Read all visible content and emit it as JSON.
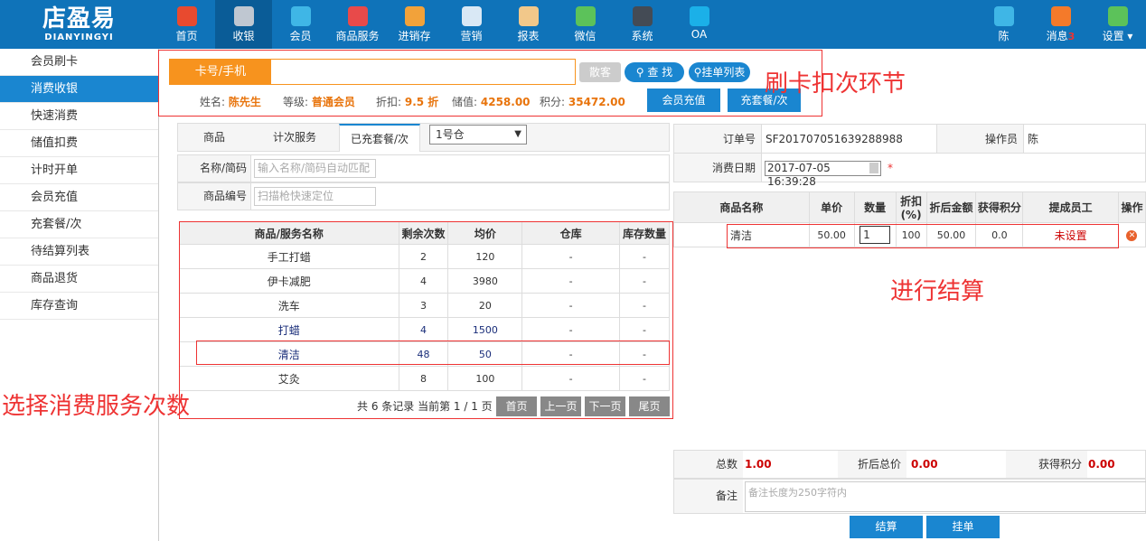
{
  "logo": {
    "cn": "店盈易",
    "en": "DIANYINGYI"
  },
  "nav": [
    {
      "label": "首页",
      "icon": "home-icon",
      "color": "#e84a2f"
    },
    {
      "label": "收银",
      "icon": "cash-register-icon",
      "color": "#bfc7d1"
    },
    {
      "label": "会员",
      "icon": "member-icon",
      "color": "#3fb6e6"
    },
    {
      "label": "商品服务",
      "icon": "goods-icon",
      "color": "#e84a4a"
    },
    {
      "label": "进销存",
      "icon": "inventory-icon",
      "color": "#f2a23a"
    },
    {
      "label": "营销",
      "icon": "megaphone-icon",
      "color": "#d9e8f5"
    },
    {
      "label": "报表",
      "icon": "report-icon",
      "color": "#f2c88a"
    },
    {
      "label": "微信",
      "icon": "wechat-icon",
      "color": "#5cc25a"
    },
    {
      "label": "系统",
      "icon": "monitor-icon",
      "color": "#444b55"
    },
    {
      "label": "OA",
      "icon": "oa-icon",
      "color": "#1bb0e8"
    }
  ],
  "right_nav": {
    "user": "陈",
    "msg": "消息",
    "msg_count": "3",
    "settings": "设置"
  },
  "sidebar": [
    "会员刷卡",
    "消费收银",
    "快速消费",
    "储值扣费",
    "计时开单",
    "会员充值",
    "充套餐/次",
    "待结算列表",
    "商品退货",
    "库存查询"
  ],
  "card": {
    "label": "卡号/手机",
    "btn_scatter": "散客",
    "btn_search": "查 找",
    "btn_hang": "挂单列表"
  },
  "member": {
    "name_k": "姓名:",
    "name": "陈先生",
    "level_k": "等级:",
    "level": "普通会员",
    "disc_k": "折扣:",
    "disc": "9.5 折",
    "store_k": "储值:",
    "store": "4258.00",
    "points_k": "积分:",
    "points": "35472.00",
    "btn_recharge": "会员充值",
    "btn_package": "充套餐/次"
  },
  "annotations": {
    "swipe": "刷卡扣次环节",
    "settle": "进行结算",
    "select": "选择消费服务次数"
  },
  "tabs": [
    "商品",
    "计次服务",
    "已充套餐/次"
  ],
  "warehouse": "1号仓",
  "filters": {
    "name_lbl": "名称/简码",
    "name_ph": "输入名称/简码自动匹配",
    "code_lbl": "商品编号",
    "code_ph": "扫描枪快速定位"
  },
  "svc_table": {
    "headers": [
      "商品/服务名称",
      "剩余次数",
      "均价",
      "仓库",
      "库存数量"
    ],
    "rows": [
      [
        "手工打蜡",
        "2",
        "120",
        "-",
        "-"
      ],
      [
        "伊卡减肥",
        "4",
        "3980",
        "-",
        "-"
      ],
      [
        "洗车",
        "3",
        "20",
        "-",
        "-"
      ],
      [
        "打蜡",
        "4",
        "1500",
        "-",
        "-"
      ],
      [
        "清洁",
        "48",
        "50",
        "-",
        "-"
      ],
      [
        "艾灸",
        "8",
        "100",
        "-",
        "-"
      ]
    ]
  },
  "pager": {
    "info": "共 6 条记录 当前第 1 / 1 页",
    "first": "首页",
    "prev": "上一页",
    "next": "下一页",
    "last": "尾页"
  },
  "order": {
    "no_k": "订单号",
    "no": "SF201707051639288988",
    "op_k": "操作员",
    "op": "陈",
    "date_k": "消费日期",
    "date": "2017-07-05 16:39:28",
    "req": "*"
  },
  "cart": {
    "headers": [
      "商品名称",
      "单价",
      "数量",
      "折扣(%)",
      "折后金额",
      "获得积分",
      "提成员工",
      "操作"
    ],
    "row": {
      "name": "清洁",
      "price": "50.00",
      "qty": "1",
      "disc": "100",
      "amount": "50.00",
      "points": "0.0",
      "staff": "未设置"
    }
  },
  "summary": {
    "total_k": "总数",
    "total": "1.00",
    "disc_total_k": "折后总价",
    "disc_total": "0.00",
    "points_k": "获得积分",
    "points": "0.00",
    "note_k": "备注",
    "note_ph": "备注长度为250字符内"
  },
  "actions": {
    "settle": "结算",
    "hang": "挂单"
  }
}
